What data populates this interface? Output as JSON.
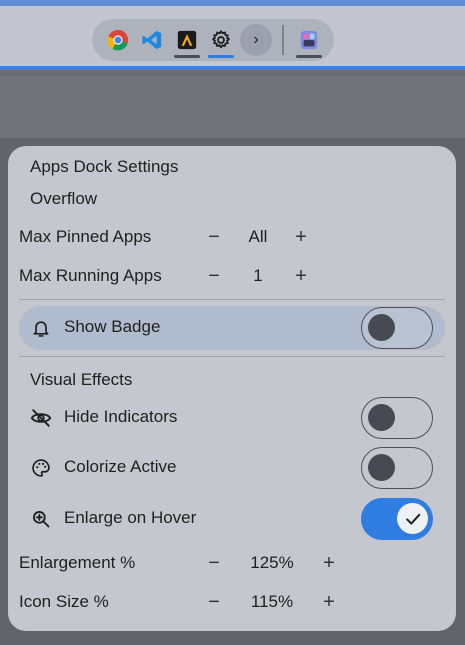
{
  "dock": {
    "apps": [
      {
        "name": "Chrome",
        "icon": "chrome-icon",
        "running": false,
        "active": false
      },
      {
        "name": "Visual Studio Code",
        "icon": "vscode-icon",
        "running": false,
        "active": false
      },
      {
        "name": "Terminal App",
        "icon": "terminal-app-icon",
        "running": true,
        "active": false
      },
      {
        "name": "Settings",
        "icon": "gear-icon",
        "running": true,
        "active": true
      }
    ],
    "overflow_glyph": "›",
    "launcher_icon": "app-launcher-icon"
  },
  "panel": {
    "title": "Apps Dock Settings",
    "overflow_section": "Overflow",
    "max_pinned": {
      "label": "Max Pinned Apps",
      "value": "All",
      "minus": "−",
      "plus": "+"
    },
    "max_running": {
      "label": "Max Running Apps",
      "value": "1",
      "minus": "−",
      "plus": "+"
    },
    "show_badge": {
      "label": "Show Badge",
      "icon": "bell-icon",
      "on": false
    },
    "visual_section": "Visual Effects",
    "hide_indicators": {
      "label": "Hide Indicators",
      "icon": "eye-off-icon",
      "on": false
    },
    "colorize_active": {
      "label": "Colorize Active",
      "icon": "palette-icon",
      "on": false
    },
    "enlarge_on_hover": {
      "label": "Enlarge on Hover",
      "icon": "zoom-in-icon",
      "on": true
    },
    "enlargement": {
      "label": "Enlargement %",
      "value": "125%",
      "minus": "−",
      "plus": "+"
    },
    "icon_size": {
      "label": "Icon Size %",
      "value": "115%",
      "minus": "−",
      "plus": "+"
    }
  },
  "colors": {
    "accent": "#2f7de1",
    "panel_bg": "#c4c7ce",
    "highlight": "#b0bbcd",
    "knob": "#474a52"
  }
}
